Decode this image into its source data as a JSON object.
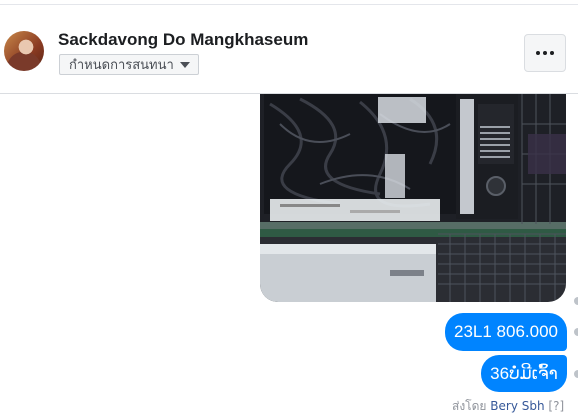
{
  "header": {
    "contact_name": "Sackdavong Do Mangkhaseum",
    "conversation_button": "กำหนดการสนทนา",
    "more_button": "..."
  },
  "messages": [
    {
      "type": "image",
      "description_icon": "image-attachment"
    },
    {
      "type": "text",
      "text": "23L1 806.000"
    },
    {
      "type": "text",
      "text": "36ບໍ່ມີເຈົ້າ"
    }
  ],
  "seen_by": {
    "prefix": "ส่งโดย",
    "name": "Bery Sbh",
    "suffix": "[?]"
  },
  "colors": {
    "bubble": "#0084ff",
    "link": "#365899"
  }
}
